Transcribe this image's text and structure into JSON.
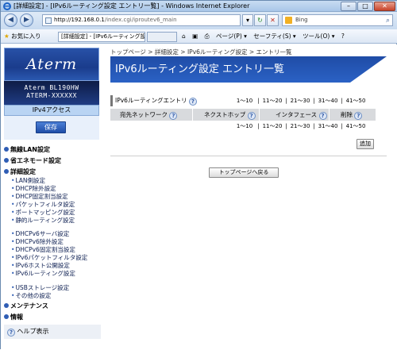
{
  "window": {
    "title": "[詳細設定] - [IPv6ルーティング設定 エントリ一覧] - Windows Internet Explorer",
    "min": "–",
    "max": "□",
    "close": "✕"
  },
  "address": {
    "url_host": "http://192.168.0.1",
    "url_path": "/index.cgi/iproutev6_main",
    "search_engine": "Bing",
    "back_icon": "arrow-left-icon",
    "forward_icon": "arrow-right-icon"
  },
  "favbar": {
    "favorites": "お気に入り",
    "tab_active": "[詳細設定] - [IPv6ルーティング設定...",
    "tab_other": "",
    "tools": {
      "page": "ページ(P) ▾",
      "safety": "セーフティ(S) ▾",
      "tools": "ツール(O) ▾",
      "help": "?"
    }
  },
  "sidebar": {
    "logo": "Aterm",
    "model_line1": "Aterm BL190HW",
    "model_line2": "ATERM-XXXXXX",
    "mode": "IPv4アクセス",
    "save_label": "保存",
    "sections": {
      "wlan": "無線LAN設定",
      "eco": "省エネモード設定",
      "detail": "詳細設定",
      "maintenance": "メンテナンス",
      "info": "情報"
    },
    "items": [
      "LAN側設定",
      "DHCP除外設定",
      "DHCP固定割当設定",
      "パケットフィルタ設定",
      "ポートマッピング設定",
      "静的ルーティング設定",
      "DHCPv6サーバ設定",
      "DHCPv6除外設定",
      "DHCPv6固定割当設定",
      "IPv6パケットフィルタ設定",
      "IPv6ホスト公開設定",
      "IPv6ルーティング設定",
      "USBストレージ設定",
      "その他の設定"
    ],
    "help": "ヘルプ表示"
  },
  "main": {
    "breadcrumb": "トップページ > 詳細設定 > IPv6ルーティング設定 > エントリ一覧",
    "title": "IPv6ルーティング設定 エントリ一覧",
    "section_label": "IPv6ルーティングエントリ",
    "pages": [
      "1～10",
      "11～20",
      "21～30",
      "31～40",
      "41～50"
    ],
    "table_headers": {
      "destination": "宛先ネットワーク",
      "nexthop": "ネクストホップ",
      "interface": "インタフェース",
      "delete": "削除"
    },
    "add_label": "追加",
    "back_label": "トップページへ戻る",
    "help_mark": "?"
  }
}
